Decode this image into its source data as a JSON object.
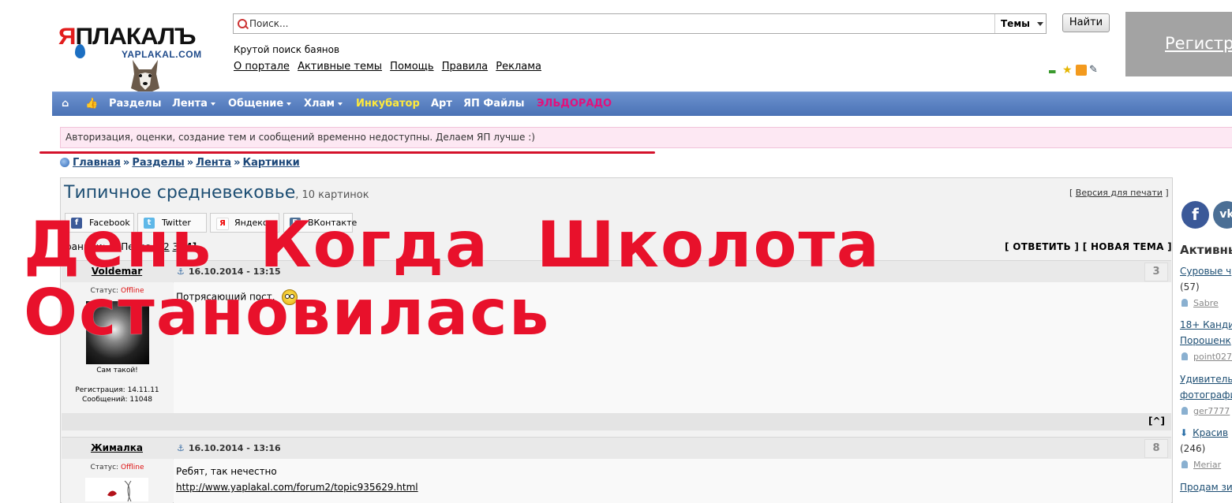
{
  "logo": {
    "word_first": "Я",
    "word_rest": "ПЛАКАЛЪ",
    "domain": "YAPLAKAL.COM"
  },
  "search": {
    "placeholder": "Поиск...",
    "scope": "Темы",
    "button": "Найти",
    "hint": "Крутой поиск баянов"
  },
  "top_links": [
    "О портале",
    "Активные темы",
    "Помощь",
    "Правила",
    "Реклама"
  ],
  "register_label": "Регистр",
  "nav": {
    "items": [
      "Разделы",
      "Лента",
      "Общение",
      "Хлам",
      "Инкубатор",
      "Арт",
      "ЯП Файлы",
      "ЭЛЬДОРАДО"
    ]
  },
  "notice": "Авторизация, оценки, создание тем и сообщений временно недоступны. Делаем ЯП лучше :)",
  "breadcrumb": [
    "Главная",
    "Разделы",
    "Лента",
    "Картинки"
  ],
  "topic": {
    "title": "Типичное средневековье",
    "count": ", 10 картинок",
    "print": "Версия для печати"
  },
  "share": [
    "Facebook",
    "Twitter",
    "Яндекс",
    "ВКонтакте"
  ],
  "pages": {
    "prefix": "траници: ( «Перва...",
    "p2": "2",
    "p3": "3",
    "current": "[4]"
  },
  "reply_links": "[ ОТВЕТИТЬ ] [ НОВАЯ ТЕМА ]",
  "posts": [
    {
      "author": "Voldemar",
      "date": "16.10.2014 - 13:15",
      "number": "3",
      "status_label": "Статус:",
      "status": "Offline",
      "caption": "Сам такой!",
      "reg": "Регистрация: 14.11.11",
      "messages": "Сообщений: 11048",
      "text": "Потрясающий пост.",
      "up": "[^]"
    },
    {
      "author": "Жималка",
      "date": "16.10.2014 - 13:16",
      "number": "8",
      "status_label": "Статус:",
      "status": "Offline",
      "text": "Ребят, так нечестно",
      "link": "http://www.yaplakal.com/forum2/topic935629.html"
    }
  ],
  "sidebar": {
    "social": [
      "f",
      "vk"
    ],
    "heading": "Активны",
    "items": [
      {
        "title": "Суровые ч",
        "count": "(57)",
        "user": "Sabre"
      },
      {
        "title": "18+ Канди",
        "title2": "Порошенк",
        "user": "point027"
      },
      {
        "title": "Удивитель",
        "title2": "фотографи",
        "user": "ger7777"
      },
      {
        "title": "Красив",
        "count": "(246)",
        "user": "Meriar"
      },
      {
        "title": "Продам зи"
      }
    ]
  },
  "overlay": {
    "line1": "День Когда Школота",
    "line2": "Остановилась"
  },
  "colors": {
    "nav": "#5a7fc2",
    "notice_bg": "#fde8f3",
    "overlay": "#e8112b",
    "title": "#1d4e73"
  }
}
